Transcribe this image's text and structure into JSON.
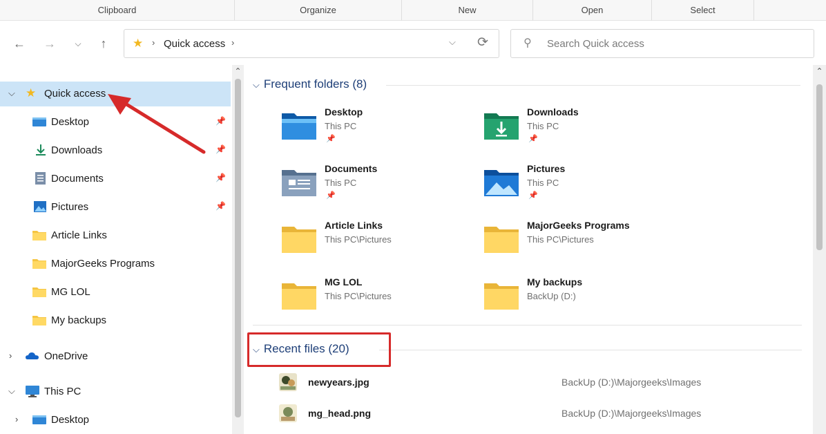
{
  "ribbon": {
    "groups": [
      {
        "label": "Clipboard"
      },
      {
        "label": "Organize"
      },
      {
        "label": "New"
      },
      {
        "label": "Open"
      },
      {
        "label": "Select"
      }
    ]
  },
  "nav": {
    "back_icon": "arrow-left-icon",
    "forward_icon": "arrow-right-icon",
    "recent_icon": "chevron-down-icon",
    "up_icon": "arrow-up-icon"
  },
  "address": {
    "crumb": "Quick access",
    "separator": "›",
    "dropdown": "⌵",
    "refresh": "⟳"
  },
  "search": {
    "placeholder": "Search Quick access"
  },
  "sidebar": {
    "items": [
      {
        "label": "Quick access",
        "icon": "star-icon",
        "expanded": true,
        "selected": true
      },
      {
        "label": "Desktop",
        "icon": "desktop-icon",
        "pinned": true
      },
      {
        "label": "Downloads",
        "icon": "download-icon",
        "pinned": true
      },
      {
        "label": "Documents",
        "icon": "documents-icon",
        "pinned": true
      },
      {
        "label": "Pictures",
        "icon": "pictures-icon",
        "pinned": true
      },
      {
        "label": "Article Links",
        "icon": "folder-icon"
      },
      {
        "label": "MajorGeeks Programs",
        "icon": "folder-icon"
      },
      {
        "label": "MG LOL",
        "icon": "folder-icon"
      },
      {
        "label": "My backups",
        "icon": "folder-icon"
      },
      {
        "label": "OneDrive",
        "icon": "cloud-icon",
        "expanded": false
      },
      {
        "label": "This PC",
        "icon": "computer-icon",
        "expanded": true
      },
      {
        "label": "Desktop",
        "icon": "desktop-icon",
        "expanded": false
      }
    ]
  },
  "main": {
    "frequent_header": "Frequent folders (8)",
    "frequent": [
      {
        "name": "Desktop",
        "path": "This PC",
        "pinned": true,
        "icon": "desktop-folder-icon"
      },
      {
        "name": "Downloads",
        "path": "This PC",
        "pinned": true,
        "icon": "downloads-folder-icon"
      },
      {
        "name": "Documents",
        "path": "This PC",
        "pinned": true,
        "icon": "documents-folder-icon"
      },
      {
        "name": "Pictures",
        "path": "This PC",
        "pinned": true,
        "icon": "pictures-folder-icon"
      },
      {
        "name": "Article Links",
        "path": "This PC\\Pictures",
        "icon": "folder-icon"
      },
      {
        "name": "MajorGeeks Programs",
        "path": "This PC\\Pictures",
        "icon": "folder-icon"
      },
      {
        "name": "MG LOL",
        "path": "This PC\\Pictures",
        "icon": "folder-icon"
      },
      {
        "name": "My backups",
        "path": "BackUp (D:)",
        "icon": "folder-icon"
      }
    ],
    "recent_header": "Recent files (20)",
    "recent": [
      {
        "name": "newyears.jpg",
        "location": "BackUp (D:)\\Majorgeeks\\Images"
      },
      {
        "name": "mg_head.png",
        "location": "BackUp (D:)\\Majorgeeks\\Images"
      }
    ]
  },
  "colors": {
    "selection": "#cce4f7",
    "section_header": "#1e3f78",
    "annotation_red": "#d62a2a",
    "folder_yellow": "#f5c542"
  }
}
